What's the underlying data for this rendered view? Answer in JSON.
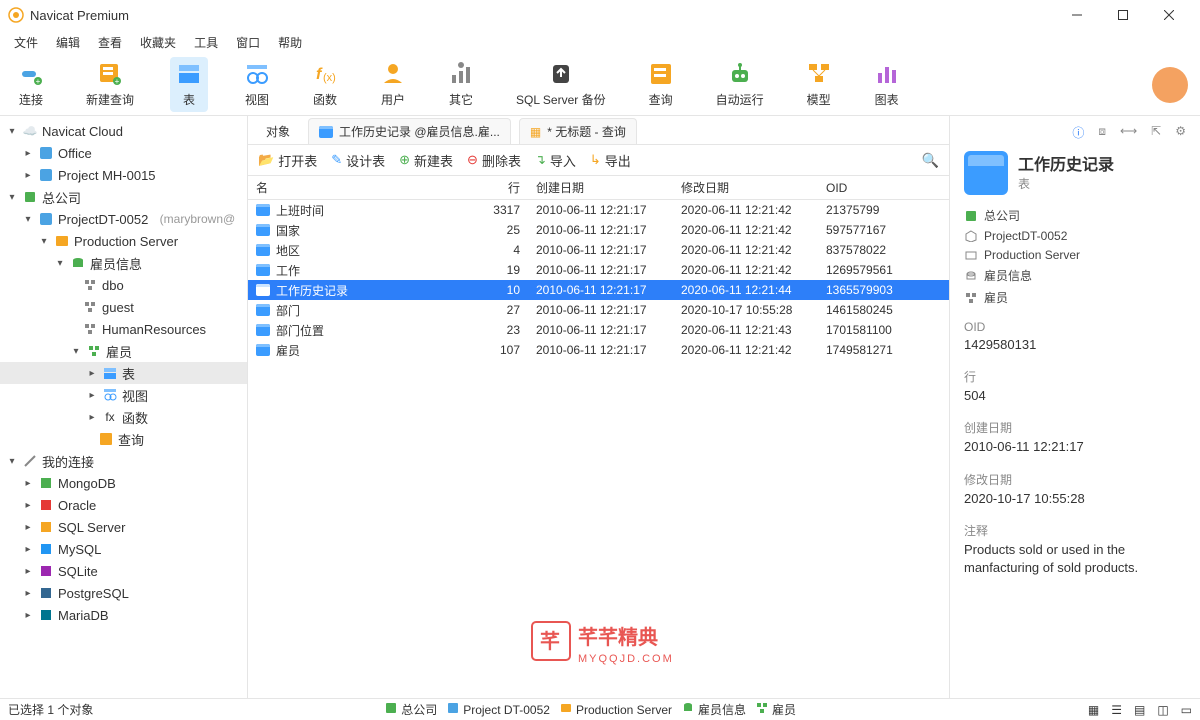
{
  "app": {
    "title": "Navicat Premium"
  },
  "menu": [
    "文件",
    "编辑",
    "查看",
    "收藏夹",
    "工具",
    "窗口",
    "帮助"
  ],
  "toolbar": [
    {
      "label": "连接",
      "icon": "plug"
    },
    {
      "label": "新建查询",
      "icon": "query-new"
    },
    {
      "label": "表",
      "icon": "table",
      "active": true
    },
    {
      "label": "视图",
      "icon": "view"
    },
    {
      "label": "函数",
      "icon": "fx"
    },
    {
      "label": "用户",
      "icon": "user"
    },
    {
      "label": "其它",
      "icon": "other"
    },
    {
      "label": "SQL Server 备份",
      "icon": "backup"
    },
    {
      "label": "查询",
      "icon": "query"
    },
    {
      "label": "自动运行",
      "icon": "robot"
    },
    {
      "label": "模型",
      "icon": "model"
    },
    {
      "label": "图表",
      "icon": "chart"
    }
  ],
  "tree": {
    "cloud": "Navicat Cloud",
    "office": "Office",
    "project": "Project MH-0015",
    "company": "总公司",
    "projectdt": "ProjectDT-0052",
    "projectdt_user": "(marybrown@",
    "prod": "Production Server",
    "db": "雇员信息",
    "schemas": [
      "dbo",
      "guest",
      "HumanResources"
    ],
    "emp": "雇员",
    "objects": [
      "表",
      "视图",
      "函数",
      "查询"
    ],
    "myconn": "我的连接",
    "dbs": [
      "MongoDB",
      "Oracle",
      "SQL Server",
      "MySQL",
      "SQLite",
      "PostgreSQL",
      "MariaDB"
    ]
  },
  "tabs": {
    "objects": "对象",
    "t1": "工作历史记录 @雇员信息.雇...",
    "t2": "* 无标题 - 查询"
  },
  "subtoolbar": {
    "open": "打开表",
    "design": "设计表",
    "newt": "新建表",
    "del": "删除表",
    "import": "导入",
    "export": "导出"
  },
  "table": {
    "headers": {
      "name": "名",
      "rows": "行",
      "created": "创建日期",
      "modified": "修改日期",
      "oid": "OID"
    },
    "rows": [
      {
        "name": "上班时间",
        "rows": "3317",
        "created": "2010-06-11 12:21:17",
        "modified": "2020-06-11 12:21:42",
        "oid": "21375799"
      },
      {
        "name": "国家",
        "rows": "25",
        "created": "2010-06-11 12:21:17",
        "modified": "2020-06-11 12:21:42",
        "oid": "597577167"
      },
      {
        "name": "地区",
        "rows": "4",
        "created": "2010-06-11 12:21:17",
        "modified": "2020-06-11 12:21:42",
        "oid": "837578022"
      },
      {
        "name": "工作",
        "rows": "19",
        "created": "2010-06-11 12:21:17",
        "modified": "2020-06-11 12:21:42",
        "oid": "1269579561"
      },
      {
        "name": "工作历史记录",
        "rows": "10",
        "created": "2010-06-11 12:21:17",
        "modified": "2020-06-11 12:21:44",
        "oid": "1365579903",
        "selected": true
      },
      {
        "name": "部门",
        "rows": "27",
        "created": "2010-06-11 12:21:17",
        "modified": "2020-10-17 10:55:28",
        "oid": "1461580245"
      },
      {
        "name": "部门位置",
        "rows": "23",
        "created": "2010-06-11 12:21:17",
        "modified": "2020-06-11 12:21:43",
        "oid": "1701581100"
      },
      {
        "name": "雇员",
        "rows": "107",
        "created": "2010-06-11 12:21:17",
        "modified": "2020-06-11 12:21:42",
        "oid": "1749581271"
      }
    ]
  },
  "details": {
    "title": "工作历史记录",
    "subtitle": "表",
    "crumbs": [
      "总公司",
      "ProjectDT-0052",
      "Production Server",
      "雇员信息",
      "雇员"
    ],
    "sections": [
      {
        "k": "OID",
        "v": "1429580131"
      },
      {
        "k": "行",
        "v": "504"
      },
      {
        "k": "创建日期",
        "v": "2010-06-11 12:21:17"
      },
      {
        "k": "修改日期",
        "v": "2020-10-17 10:55:28"
      },
      {
        "k": "注释",
        "v": "Products sold or used in the manfacturing of sold products."
      }
    ]
  },
  "status": {
    "sel": "已选择 1 个对象",
    "path": [
      "总公司",
      "Project DT-0052",
      "Production Server",
      "雇员信息",
      "雇员"
    ]
  },
  "watermark": {
    "brand": "芊芊精典",
    "url": "MYQQJD.COM"
  }
}
